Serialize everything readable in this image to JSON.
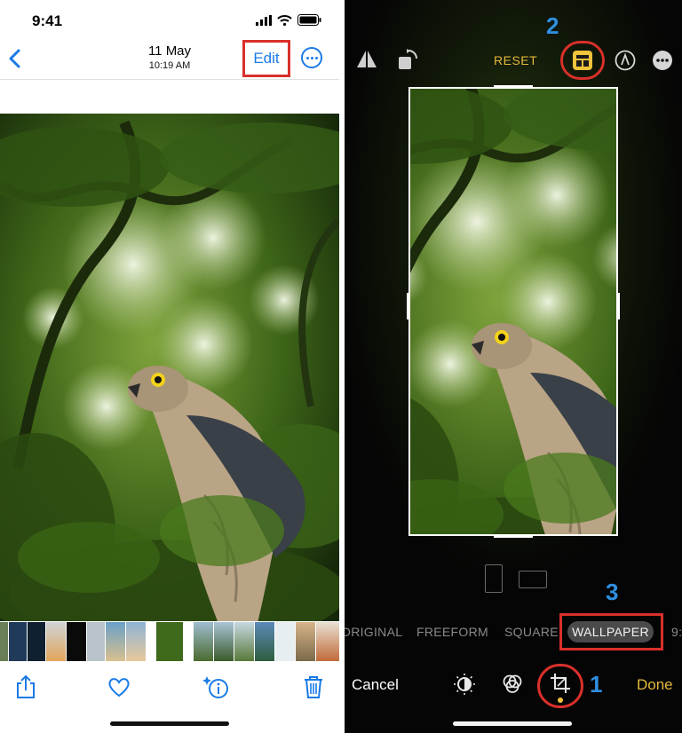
{
  "left": {
    "status": {
      "time": "9:41"
    },
    "nav": {
      "date": "11 May",
      "time": "10:19 AM",
      "edit_label": "Edit"
    }
  },
  "right": {
    "reset_label": "RESET",
    "cancel_label": "Cancel",
    "done_label": "Done",
    "aspects": [
      "ORIGINAL",
      "FREEFORM",
      "SQUARE",
      "WALLPAPER",
      "9:"
    ],
    "selected_aspect": "WALLPAPER",
    "step_labels": {
      "one": "1",
      "two": "2",
      "three": "3"
    }
  },
  "icons": {
    "left_toolbar": [
      "share-icon",
      "heart-icon",
      "info-sparkle-icon",
      "trash-icon"
    ],
    "right_top": [
      "flip-icon",
      "rotate-icon",
      "aspect-ratio-icon",
      "markup-icon",
      "more-icon"
    ],
    "right_bottom": [
      "adjust-icon",
      "filters-icon",
      "crop-icon"
    ]
  },
  "colors": {
    "accent_blue": "#1a7ae6",
    "annotation_red": "#d9302b",
    "annotation_number": "#2f8fe0",
    "ios_yellow": "#e4b93a"
  }
}
